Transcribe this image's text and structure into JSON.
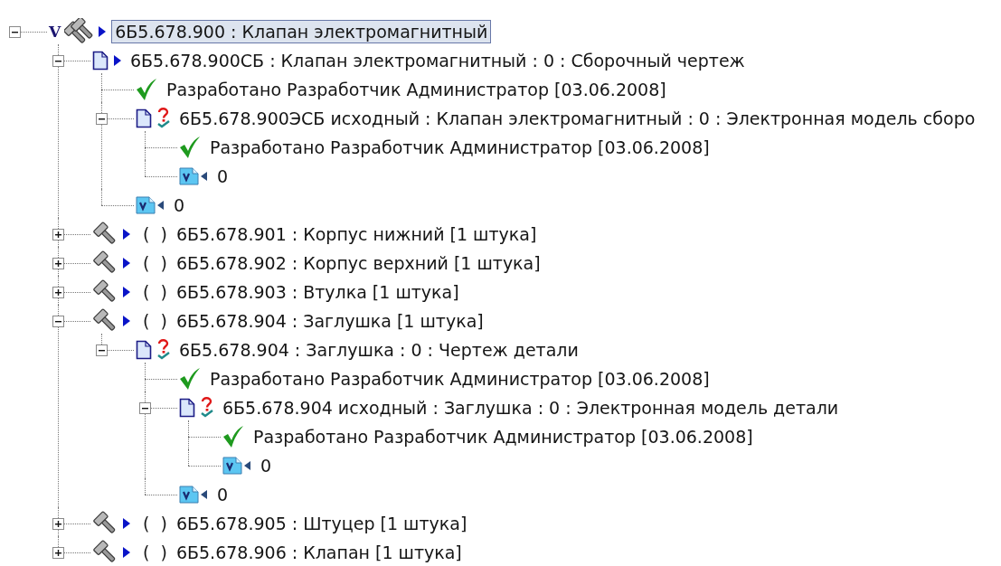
{
  "tree": {
    "root": {
      "kind": "assembly",
      "badge": "V",
      "linked": true,
      "label": "6Б5.678.900 : Клапан электромагнитный",
      "selected": true,
      "expanded": true,
      "children": [
        {
          "kind": "document",
          "linked": true,
          "pending": false,
          "label": "6Б5.678.900СБ : Клапан электромагнитный : 0 : Сборочный чертеж",
          "selected": false,
          "expanded": true,
          "children": [
            {
              "kind": "approval",
              "label": "Разработано Разработчик Администратор [03.06.2008]",
              "selected": false
            },
            {
              "kind": "document",
              "linked": false,
              "pending": true,
              "label": "6Б5.678.900ЭСБ исходный : Клапан электромагнитный : 0 : Электронная модель сборо",
              "selected": false,
              "expanded": true,
              "children": [
                {
                  "kind": "approval",
                  "label": "Разработано Разработчик Администратор [03.06.2008]",
                  "selected": false
                },
                {
                  "kind": "version",
                  "label": "0",
                  "selected": false
                }
              ]
            },
            {
              "kind": "version",
              "label": "0",
              "selected": false
            }
          ]
        },
        {
          "kind": "part",
          "linked": true,
          "prefix": "(  )",
          "label": "6Б5.678.901 : Корпус нижний [1 штука]",
          "selected": false,
          "expanded": false
        },
        {
          "kind": "part",
          "linked": true,
          "prefix": "(  )",
          "label": "6Б5.678.902 : Корпус верхний [1 штука]",
          "selected": false,
          "expanded": false
        },
        {
          "kind": "part",
          "linked": true,
          "prefix": "(  )",
          "label": "6Б5.678.903 : Втулка [1 штука]",
          "selected": false,
          "expanded": false
        },
        {
          "kind": "part",
          "linked": true,
          "prefix": "(  )",
          "label": "6Б5.678.904 : Заглушка [1 штука]",
          "selected": false,
          "expanded": true,
          "children": [
            {
              "kind": "document",
              "linked": false,
              "pending": true,
              "label": "6Б5.678.904 : Заглушка : 0 : Чертеж детали",
              "selected": false,
              "expanded": true,
              "children": [
                {
                  "kind": "approval",
                  "label": "Разработано Разработчик Администратор [03.06.2008]",
                  "selected": false
                },
                {
                  "kind": "document",
                  "linked": false,
                  "pending": true,
                  "label": "6Б5.678.904 исходный : Заглушка : 0 : Электронная модель детали",
                  "selected": false,
                  "expanded": true,
                  "children": [
                    {
                      "kind": "approval",
                      "label": "Разработано Разработчик Администратор [03.06.2008]",
                      "selected": false
                    },
                    {
                      "kind": "version",
                      "label": "0",
                      "selected": false
                    }
                  ]
                },
                {
                  "kind": "version",
                  "label": "0",
                  "selected": false
                }
              ]
            }
          ]
        },
        {
          "kind": "part",
          "linked": true,
          "prefix": "(  )",
          "label": "6Б5.678.905 : Штуцер [1 штука]",
          "selected": false,
          "expanded": false
        },
        {
          "kind": "part",
          "linked": true,
          "prefix": "(  )",
          "label": "6Б5.678.906 : Клапан [1 штука]",
          "selected": false,
          "expanded": false
        }
      ]
    }
  }
}
